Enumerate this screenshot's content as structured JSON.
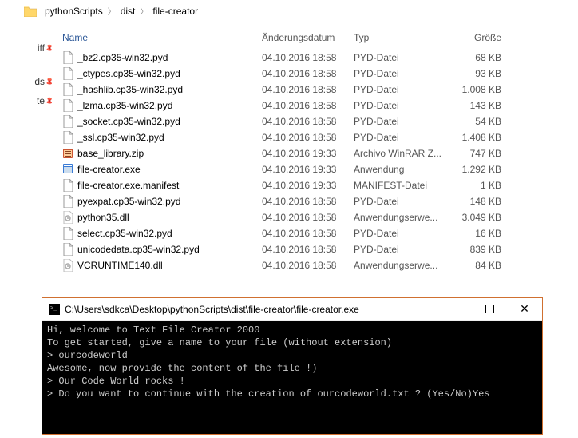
{
  "breadcrumb": {
    "items": [
      "pythonScripts",
      "dist",
      "file-creator"
    ]
  },
  "sidebar": {
    "items": [
      "iff",
      "ds",
      "te"
    ]
  },
  "columns": {
    "name": "Name",
    "date": "Änderungsdatum",
    "type": "Typ",
    "size": "Größe"
  },
  "files": [
    {
      "icon": "doc",
      "name": "_bz2.cp35-win32.pyd",
      "date": "04.10.2016 18:58",
      "type": "PYD-Datei",
      "size": "68 KB"
    },
    {
      "icon": "doc",
      "name": "_ctypes.cp35-win32.pyd",
      "date": "04.10.2016 18:58",
      "type": "PYD-Datei",
      "size": "93 KB"
    },
    {
      "icon": "doc",
      "name": "_hashlib.cp35-win32.pyd",
      "date": "04.10.2016 18:58",
      "type": "PYD-Datei",
      "size": "1.008 KB"
    },
    {
      "icon": "doc",
      "name": "_lzma.cp35-win32.pyd",
      "date": "04.10.2016 18:58",
      "type": "PYD-Datei",
      "size": "143 KB"
    },
    {
      "icon": "doc",
      "name": "_socket.cp35-win32.pyd",
      "date": "04.10.2016 18:58",
      "type": "PYD-Datei",
      "size": "54 KB"
    },
    {
      "icon": "doc",
      "name": "_ssl.cp35-win32.pyd",
      "date": "04.10.2016 18:58",
      "type": "PYD-Datei",
      "size": "1.408 KB"
    },
    {
      "icon": "zip",
      "name": "base_library.zip",
      "date": "04.10.2016 19:33",
      "type": "Archivo WinRAR Z...",
      "size": "747 KB"
    },
    {
      "icon": "exe",
      "name": "file-creator.exe",
      "date": "04.10.2016 19:33",
      "type": "Anwendung",
      "size": "1.292 KB"
    },
    {
      "icon": "doc",
      "name": "file-creator.exe.manifest",
      "date": "04.10.2016 19:33",
      "type": "MANIFEST-Datei",
      "size": "1 KB"
    },
    {
      "icon": "doc",
      "name": "pyexpat.cp35-win32.pyd",
      "date": "04.10.2016 18:58",
      "type": "PYD-Datei",
      "size": "148 KB"
    },
    {
      "icon": "dll",
      "name": "python35.dll",
      "date": "04.10.2016 18:58",
      "type": "Anwendungserwe...",
      "size": "3.049 KB"
    },
    {
      "icon": "doc",
      "name": "select.cp35-win32.pyd",
      "date": "04.10.2016 18:58",
      "type": "PYD-Datei",
      "size": "16 KB"
    },
    {
      "icon": "doc",
      "name": "unicodedata.cp35-win32.pyd",
      "date": "04.10.2016 18:58",
      "type": "PYD-Datei",
      "size": "839 KB"
    },
    {
      "icon": "dll",
      "name": "VCRUNTIME140.dll",
      "date": "04.10.2016 18:58",
      "type": "Anwendungserwe...",
      "size": "84 KB"
    }
  ],
  "console": {
    "title": "C:\\Users\\sdkca\\Desktop\\pythonScripts\\dist\\file-creator\\file-creator.exe",
    "lines": [
      "Hi, welcome to Text File Creator 2000",
      "To get started, give a name to your file (without extension)",
      "> ourcodeworld",
      "Awesome, now provide the content of the file !)",
      "> Our Code World rocks !",
      "> Do you want to continue with the creation of ourcodeworld.txt ? (Yes/No)Yes"
    ]
  }
}
